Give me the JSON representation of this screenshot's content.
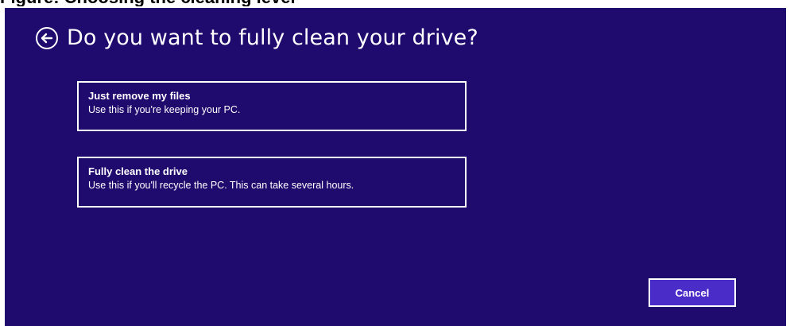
{
  "caption": "Figure: Choosing the cleaning level",
  "header": {
    "back_icon": "back-arrow-circle-icon",
    "title": "Do you want to fully clean your drive?"
  },
  "options": [
    {
      "title": "Just remove my files",
      "description": "Use this if you're keeping your PC."
    },
    {
      "title": "Fully clean the drive",
      "description": "Use this if you'll recycle the PC. This can take several hours."
    }
  ],
  "footer": {
    "cancel_label": "Cancel"
  },
  "colors": {
    "background": "#1f0a6e",
    "accent": "#4a2cc8",
    "text": "#ffffff"
  }
}
